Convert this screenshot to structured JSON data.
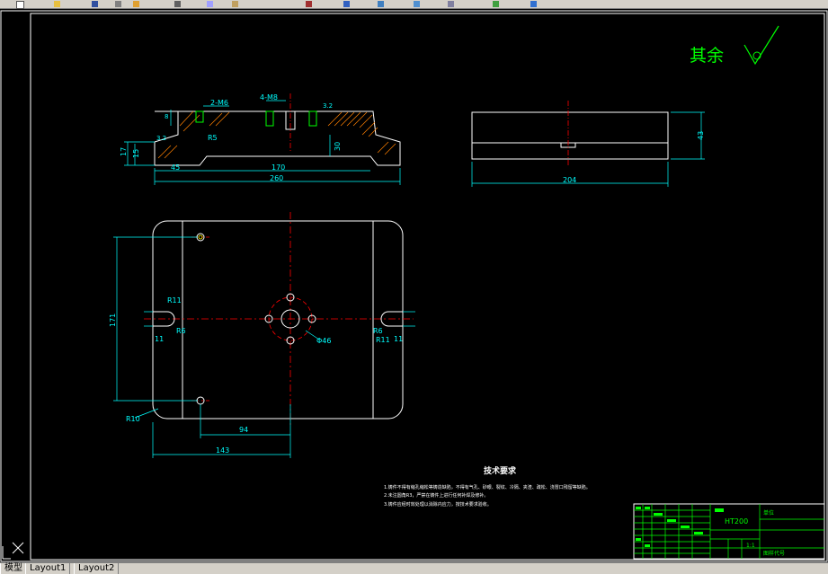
{
  "toolbar": {
    "icons": [
      "new-icon",
      "open-icon",
      "save-icon",
      "print-icon",
      "preview-icon",
      "cut-icon",
      "copy-icon",
      "paste-icon",
      "undo-icon",
      "redo-icon",
      "pan-icon",
      "zoom-icon",
      "properties-icon",
      "layer-icon",
      "help-icon"
    ]
  },
  "drawing": {
    "surface_finish": "其余",
    "front_view": {
      "dims": {
        "thread_a": "2-M6",
        "thread_b": "4-M8",
        "dim_8": "8",
        "dim_17": "17",
        "dim_15": "15",
        "dim_45": "45",
        "dim_170": "170",
        "dim_260": "260",
        "dim_30": "30",
        "radius": "R5",
        "finish_a": "3.2",
        "finish_b": "3.2"
      }
    },
    "side_view": {
      "dims": {
        "width": "204",
        "height": "43"
      }
    },
    "top_view": {
      "dims": {
        "height": "171",
        "r11_left": "R11",
        "r6_left": "R6",
        "w11_left": "11",
        "r6_right": "R6",
        "r11_right": "R11",
        "w11_right": "11",
        "hole": "Φ46",
        "corner": "R10",
        "dim_94": "94",
        "dim_143": "143"
      }
    },
    "tech_requirements": {
      "title": "技术要求",
      "lines": [
        "1.铸件不得有缩孔缩松等铸造缺陷，不得有气孔、砂眼、裂纹、冷隔、夹渣、疏松、浇冒口残留等缺陷。",
        "2.未注圆角R3，严禁在铸件上进行任何补焊及修补。",
        "3.铸件应经时效处理以消除内应力，按技术要求验收。"
      ]
    },
    "title_block": {
      "material": "HT200",
      "scale": "1:1",
      "drawing_no": "图样代号",
      "company": "单位"
    }
  },
  "tabs": {
    "model": "模型",
    "layout1": "Layout1",
    "layout2": "Layout2"
  },
  "colors": {
    "background": "#000000",
    "outline": "#ffffff",
    "dimension": "#00ffff",
    "centerline": "#ff0000",
    "frame_green": "#00ff00",
    "hatch": "#ff8000"
  }
}
